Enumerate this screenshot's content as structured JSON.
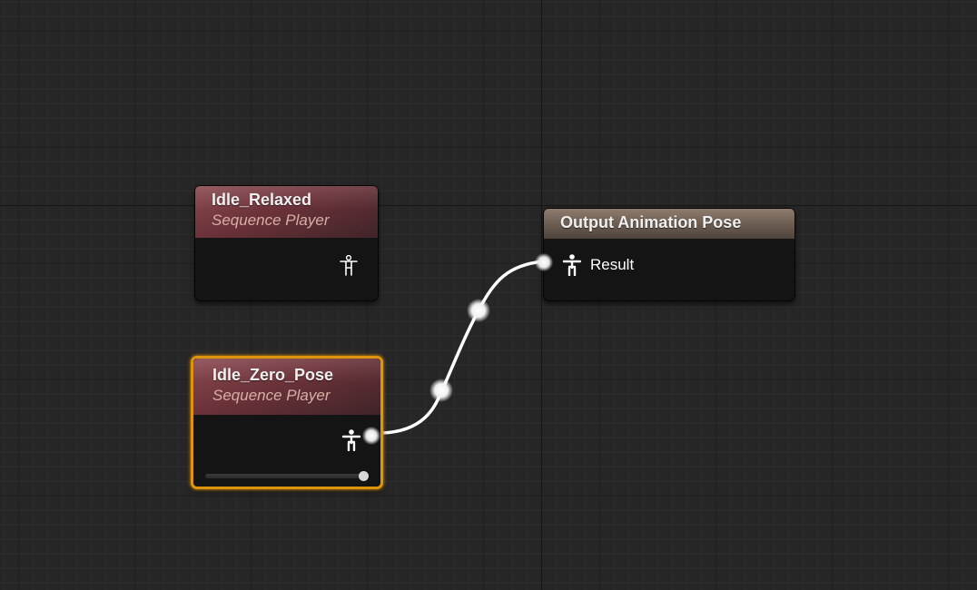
{
  "nodes": {
    "idle_relaxed": {
      "title": "Idle_Relaxed",
      "subtitle": "Sequence Player",
      "output_pin_icon": "pose-icon"
    },
    "idle_zero_pose": {
      "title": "Idle_Zero_Pose",
      "subtitle": "Sequence Player",
      "output_pin_icon": "pose-icon",
      "selected": true,
      "play_position": 1.0
    },
    "output_pose": {
      "title": "Output Animation Pose",
      "input_pin_label": "Result",
      "input_pin_icon": "pose-icon"
    }
  },
  "connections": [
    {
      "from": "Idle_Zero_Pose",
      "to": "Output Animation Pose.Result",
      "reroute_nodes": 2
    }
  ],
  "colors": {
    "background": "#262626",
    "sequence_header": "#7a3d44",
    "output_header": "#8e7c6e",
    "selection": "#e0940c",
    "wire": "#ffffff"
  }
}
